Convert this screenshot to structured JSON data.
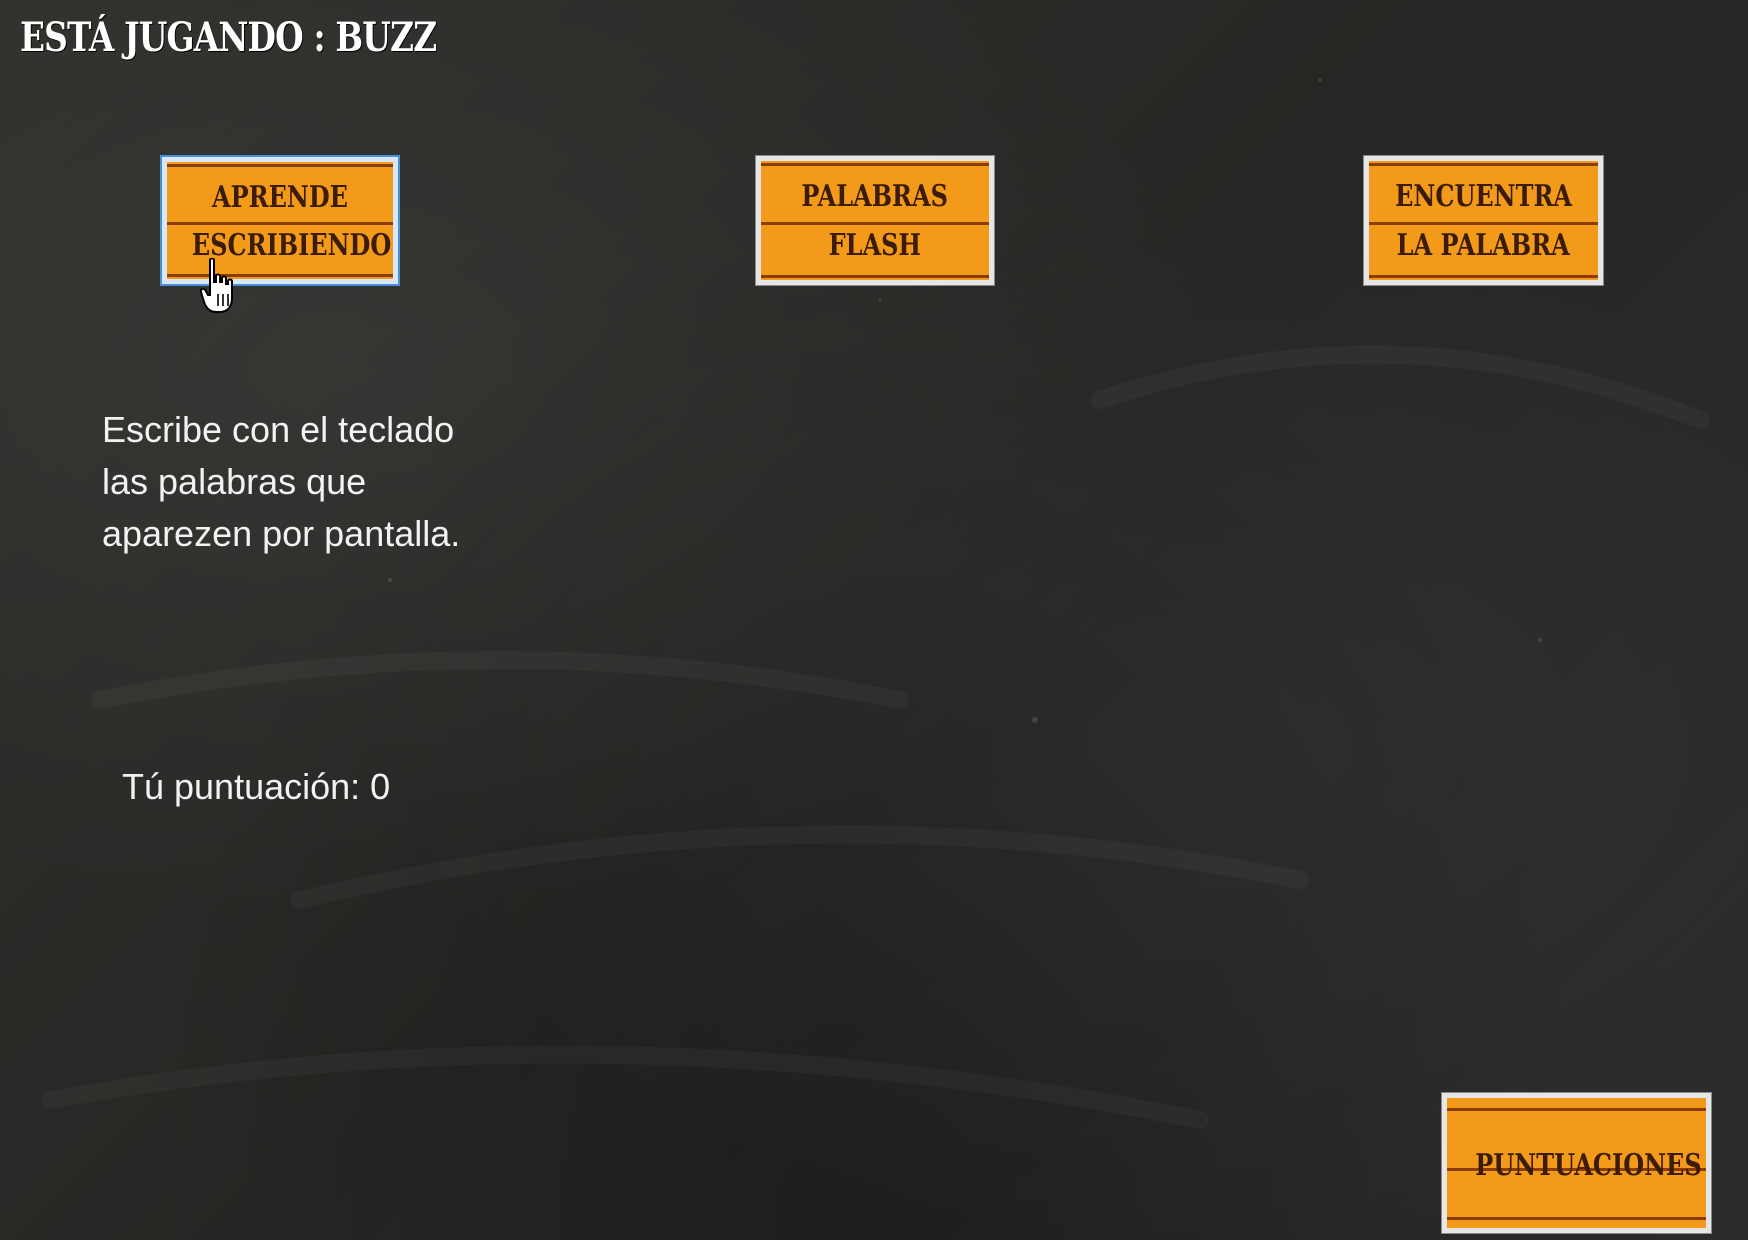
{
  "header": {
    "playing_label": "ESTÁ JUGANDO : BUZZ"
  },
  "games": [
    {
      "line1": "APRENDE",
      "line2": "ESCRIBIENDO",
      "selected": true
    },
    {
      "line1": "PALABRAS",
      "line2": "FLASH",
      "selected": false
    },
    {
      "line1": "ENCUENTRA",
      "line2": "LA PALABRA",
      "selected": false
    }
  ],
  "description": {
    "lines": [
      "Escribe con el teclado",
      "las palabras que",
      "aparezen por pantalla."
    ]
  },
  "score": {
    "text": "Tú puntuación: 0"
  },
  "scores_button": {
    "label": "PUNTUACIONES"
  },
  "colors": {
    "button_fill": "#f39a1a",
    "button_text": "#3a1c08",
    "board": "#2a2a28"
  }
}
